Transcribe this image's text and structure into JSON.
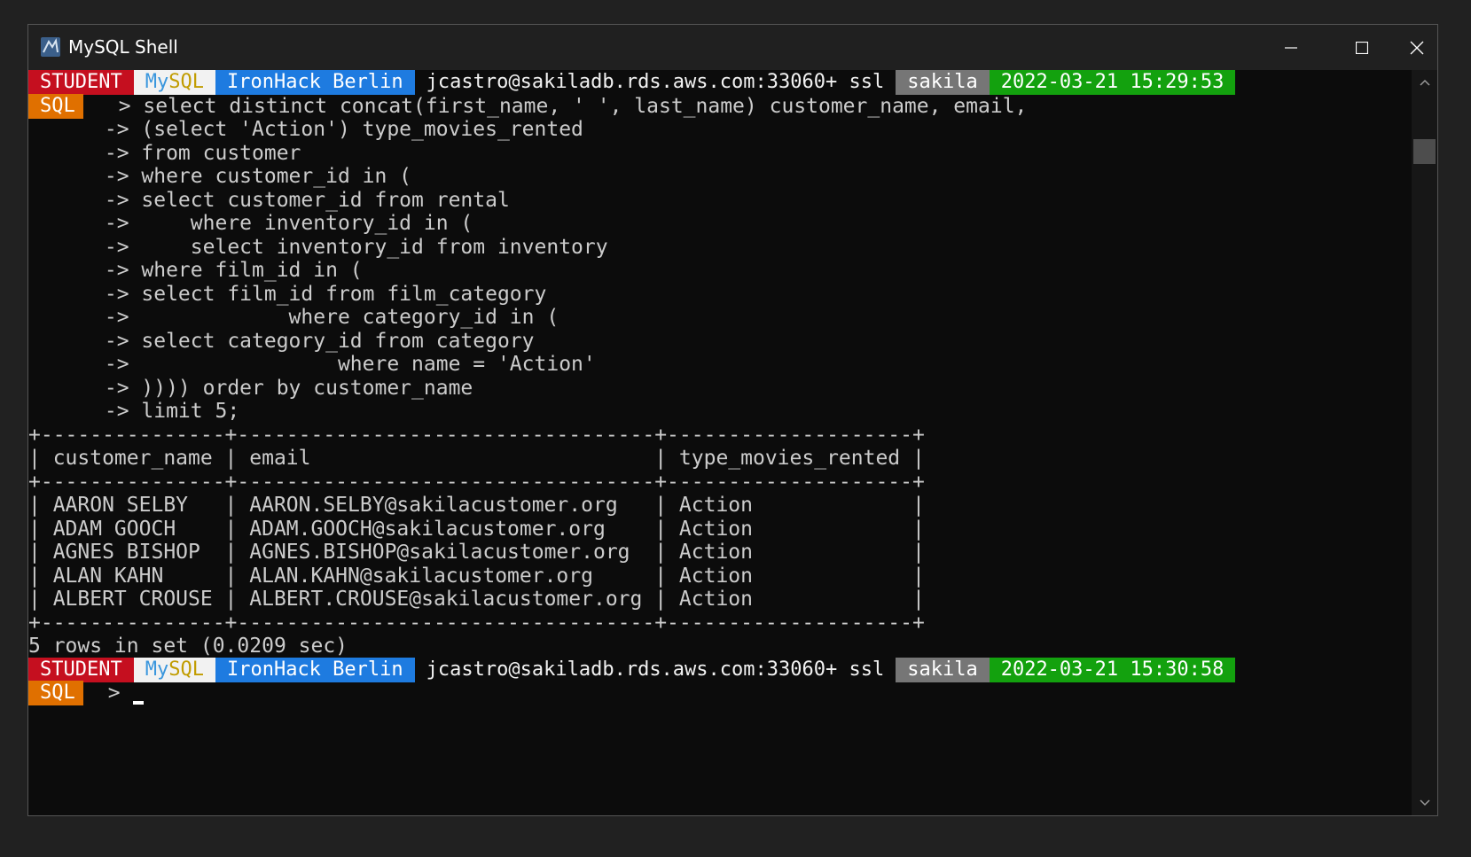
{
  "window": {
    "title": "MySQL Shell"
  },
  "prompt1": {
    "user": "STUDENT",
    "mysql_my": "My",
    "mysql_sql": "SQL",
    "location": "IronHack Berlin",
    "connection": "jcastro@sakiladb.rds.aws.com:33060+ ssl",
    "schema": "sakila",
    "timestamp": "2022-03-21 15:29:53",
    "mode": "SQL"
  },
  "query_lines": [
    "  > select distinct concat(first_name, ' ', last_name) customer_name, email,",
    " -> (select 'Action') type_movies_rented",
    " -> from customer",
    " -> where customer_id in (",
    " -> select customer_id from rental",
    " ->     where inventory_id in (",
    " ->     select inventory_id from inventory",
    " -> where film_id in (",
    " -> select film_id from film_category",
    " ->             where category_id in (",
    " -> select category_id from category",
    " ->                 where name = 'Action'",
    " -> )))) order by customer_name",
    " -> limit 5;"
  ],
  "result_table": {
    "border": "+---------------+----------------------------------+--------------------+",
    "columns": [
      "customer_name",
      "email",
      "type_movies_rented"
    ],
    "rows": [
      [
        "AARON SELBY",
        "AARON.SELBY@sakilacustomer.org",
        "Action"
      ],
      [
        "ADAM GOOCH",
        "ADAM.GOOCH@sakilacustomer.org",
        "Action"
      ],
      [
        "AGNES BISHOP",
        "AGNES.BISHOP@sakilacustomer.org",
        "Action"
      ],
      [
        "ALAN KAHN",
        "ALAN.KAHN@sakilacustomer.org",
        "Action"
      ],
      [
        "ALBERT CROUSE",
        "ALBERT.CROUSE@sakilacustomer.org",
        "Action"
      ]
    ],
    "summary": "5 rows in set (0.0209 sec)"
  },
  "prompt2": {
    "user": "STUDENT",
    "mysql_my": "My",
    "mysql_sql": "SQL",
    "location": "IronHack Berlin",
    "connection": "jcastro@sakiladb.rds.aws.com:33060+ ssl",
    "schema": "sakila",
    "timestamp": "2022-03-21 15:30:58",
    "mode": "SQL",
    "input_marker": "  >"
  },
  "colors": {
    "student": "#c50f1f",
    "ironhack": "#1e7be0",
    "schema": "#767676",
    "timestamp": "#13a10e",
    "mode": "#e07000"
  }
}
